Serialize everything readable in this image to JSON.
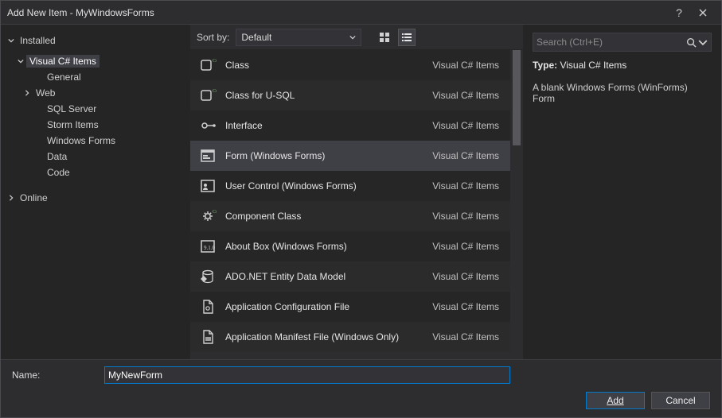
{
  "window": {
    "title": "Add New Item - MyWindowsForms"
  },
  "tree": {
    "installed": "Installed",
    "vcs": "Visual C# Items",
    "children": [
      "General",
      "Web",
      "SQL Server",
      "Storm Items",
      "Windows Forms",
      "Data",
      "Code"
    ],
    "online": "Online"
  },
  "toolbar": {
    "sort_label": "Sort by:",
    "sort_value": "Default"
  },
  "search": {
    "placeholder": "Search (Ctrl+E)"
  },
  "items": [
    {
      "name": "Class",
      "category": "Visual C# Items",
      "icon": "class",
      "selected": false
    },
    {
      "name": "Class for U-SQL",
      "category": "Visual C# Items",
      "icon": "class",
      "selected": false
    },
    {
      "name": "Interface",
      "category": "Visual C# Items",
      "icon": "interface",
      "selected": false
    },
    {
      "name": "Form (Windows Forms)",
      "category": "Visual C# Items",
      "icon": "form",
      "selected": true
    },
    {
      "name": "User Control (Windows Forms)",
      "category": "Visual C# Items",
      "icon": "usercontrol",
      "selected": false
    },
    {
      "name": "Component Class",
      "category": "Visual C# Items",
      "icon": "component",
      "selected": false
    },
    {
      "name": "About Box (Windows Forms)",
      "category": "Visual C# Items",
      "icon": "aboutbox",
      "selected": false
    },
    {
      "name": "ADO.NET Entity Data Model",
      "category": "Visual C# Items",
      "icon": "ado",
      "selected": false
    },
    {
      "name": "Application Configuration File",
      "category": "Visual C# Items",
      "icon": "config",
      "selected": false
    },
    {
      "name": "Application Manifest File (Windows Only)",
      "category": "Visual C# Items",
      "icon": "manifest",
      "selected": false
    }
  ],
  "info": {
    "type_label": "Type:",
    "type_value": "Visual C# Items",
    "description": "A blank Windows Forms (WinForms) Form"
  },
  "name_field": {
    "label": "Name:",
    "value": "MyNewForm"
  },
  "buttons": {
    "add": "Add",
    "cancel": "Cancel"
  }
}
